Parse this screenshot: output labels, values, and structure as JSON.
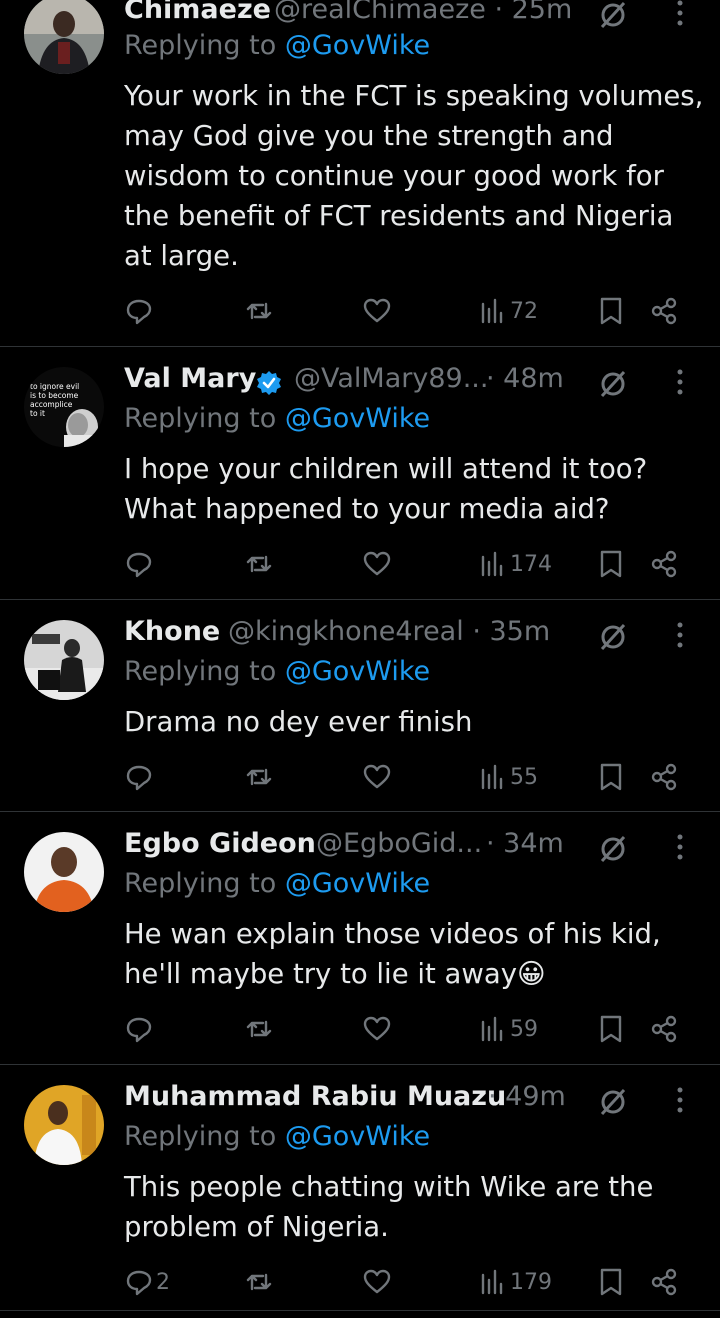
{
  "tweets": [
    {
      "name": "Chimaeze",
      "handle": "@realChimaeze",
      "time": "25m",
      "verified": false,
      "replying_prefix": "Replying to ",
      "replying_to": "@GovWike",
      "body": "Your work in the FCT is speaking volumes, may God give you the strength and wisdom to continue your good work for the benefit of FCT residents and Nigeria at large.",
      "reply_count": "",
      "views": "72"
    },
    {
      "name": "Val Mary",
      "handle": "@ValMary89...",
      "time": "48m",
      "verified": true,
      "replying_prefix": "Replying to ",
      "replying_to": "@GovWike",
      "body": "I hope your children will attend it too? What happened to your media aid?",
      "reply_count": "",
      "views": "174",
      "avatar_text": [
        "to ignore evil",
        "is to become",
        "accomplice",
        "to it"
      ]
    },
    {
      "name": "Khone",
      "handle": "@kingkhone4real",
      "time": "35m",
      "verified": false,
      "replying_prefix": "Replying to ",
      "replying_to": "@GovWike",
      "body": "Drama no dey ever finish",
      "reply_count": "",
      "views": "55"
    },
    {
      "name": "Egbo Gideon",
      "handle": "@EgboGid...",
      "time": "34m",
      "verified": false,
      "replying_prefix": "Replying to ",
      "replying_to": "@GovWike",
      "body": "He wan explain those videos of his kid, he'll maybe try to lie it away😀",
      "reply_count": "",
      "views": "59"
    },
    {
      "name": "Muhammad Rabiu Muazu",
      "handle": "",
      "time": "49m",
      "verified": false,
      "replying_prefix": "Replying to ",
      "replying_to": "@GovWike",
      "body": "This people chatting with Wike are the problem of Nigeria.",
      "reply_count": "2",
      "views": "179"
    }
  ],
  "separator": " · ",
  "icons": {
    "reply": "reply-icon",
    "retweet": "retweet-icon",
    "like": "heart-icon",
    "views": "views-icon",
    "bookmark": "bookmark-icon",
    "share": "share-icon",
    "grok": "grok-icon",
    "more": "more-icon",
    "verified": "verified-badge-icon"
  },
  "colors": {
    "background": "#000000",
    "text": "#e7e9ea",
    "muted": "#71767b",
    "accent": "#1d9bf0",
    "divider": "#2f3336"
  }
}
